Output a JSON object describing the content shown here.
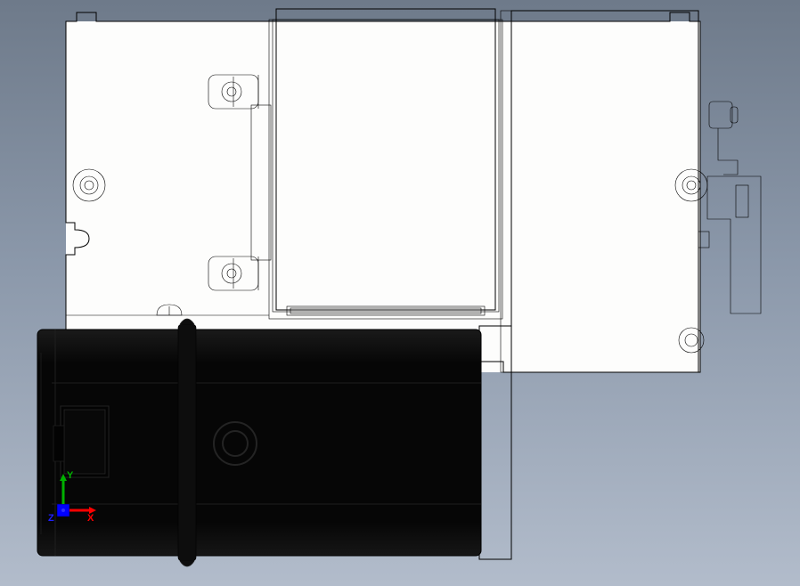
{
  "app": "CAD Viewer",
  "view": "Right (orthographic, shaded with edges)",
  "triad": {
    "x": {
      "label": "X",
      "color": "#ff0000"
    },
    "y": {
      "label": "Y",
      "color": "#00c000"
    },
    "z": {
      "label": "Z",
      "color": "#0000ff"
    }
  },
  "model": {
    "description": "Mechanical assembly — main housing plate with raised cover, two circular bosses on left side, mounting flanges, side bracket, and attached black motor/gearbox unit below",
    "colors": {
      "body": "#fbfbfa",
      "body_shade": "#e6e6e4",
      "motor": "#0a0a0a",
      "motor_gloss": "#1a1a1a",
      "bracket": "#9c9c96",
      "edge": "#000000"
    },
    "components": {
      "main_plate": {
        "shape": "rectangular plate",
        "holes": 2,
        "notches": 2
      },
      "cover": {
        "shape": "raised rectangle",
        "bosses": 2
      },
      "side_bracket": {
        "shape": "L-bracket with slot"
      },
      "motor": {
        "shape": "cylindrical motor with terminal box"
      }
    }
  }
}
